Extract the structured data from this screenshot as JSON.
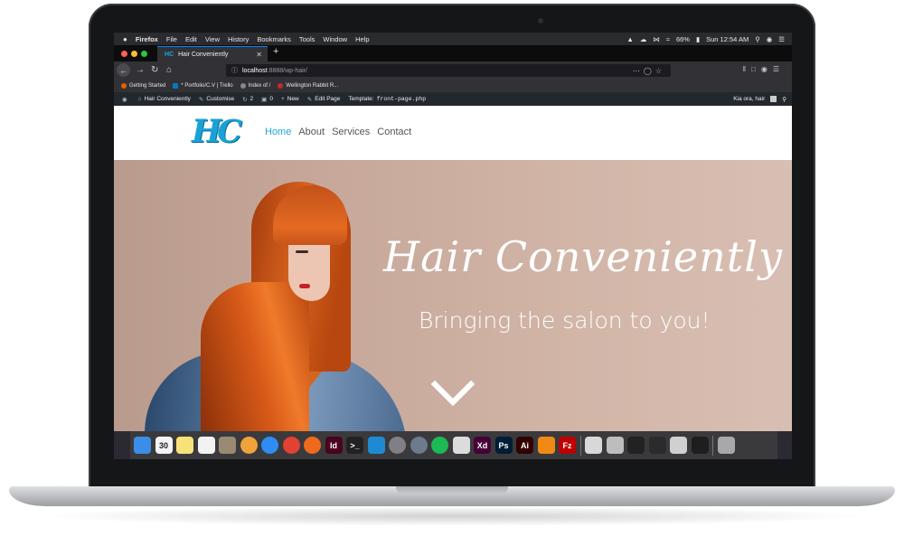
{
  "menubar": {
    "apple": "",
    "app": "Firefox",
    "items": [
      "File",
      "Edit",
      "View",
      "History",
      "Bookmarks",
      "Tools",
      "Window",
      "Help"
    ],
    "battery": "66%",
    "clock": "Sun 12:54 AM"
  },
  "tab": {
    "title": "Hair Conveniently",
    "close": "✕",
    "new": "+"
  },
  "url": {
    "host": "localhost",
    "path": ":8888/wp-hair/"
  },
  "bookmarks": [
    {
      "label": "Getting Started",
      "color": "#e66000"
    },
    {
      "label": "* Portfolio/C.V | Trello",
      "color": "#0079bf"
    },
    {
      "label": "Index of /",
      "color": "#888888"
    },
    {
      "label": "Wellington Rabbit R...",
      "color": "#c62828"
    }
  ],
  "wpbar": {
    "site": "Hair Conveniently",
    "customise": "Customise",
    "updates": "2",
    "comments": "0",
    "new": "New",
    "edit": "Edit Page",
    "template_label": "Template:",
    "template_file": "front-page.php",
    "greeting": "Kia ora, hair"
  },
  "site": {
    "logo": "HC",
    "nav": [
      "Home",
      "About",
      "Services",
      "Contact"
    ]
  },
  "hero": {
    "title": "Hair Conveniently",
    "subtitle": "Bringing the salon to you!"
  },
  "dock": [
    {
      "name": "finder",
      "label": "",
      "color": "#3b8de8"
    },
    {
      "name": "calendar",
      "label": "30",
      "color": "#f4f4f4"
    },
    {
      "name": "notes",
      "label": "",
      "color": "#f7e27a"
    },
    {
      "name": "reminders",
      "label": "",
      "color": "#f2f2f2"
    },
    {
      "name": "preview",
      "label": "",
      "color": "#9a8a74"
    },
    {
      "name": "photos",
      "label": "",
      "color": "#f0a23b"
    },
    {
      "name": "safari",
      "label": "",
      "color": "#2f8df2"
    },
    {
      "name": "chrome",
      "label": "",
      "color": "#e34133"
    },
    {
      "name": "firefox",
      "label": "",
      "color": "#f06a1d"
    },
    {
      "name": "indesign",
      "label": "Id",
      "color": "#49021f"
    },
    {
      "name": "terminal",
      "label": ">_",
      "color": "#222222"
    },
    {
      "name": "vscode",
      "label": "",
      "color": "#1f8ad2"
    },
    {
      "name": "system-prefs",
      "label": "",
      "color": "#7f7f85"
    },
    {
      "name": "launchpad",
      "label": "",
      "color": "#6d7b8c"
    },
    {
      "name": "spotify",
      "label": "",
      "color": "#1db954"
    },
    {
      "name": "sequel",
      "label": "",
      "color": "#dcdcdc"
    },
    {
      "name": "xd",
      "label": "Xd",
      "color": "#470137"
    },
    {
      "name": "photoshop",
      "label": "Ps",
      "color": "#001d34"
    },
    {
      "name": "illustrator",
      "label": "Ai",
      "color": "#330000"
    },
    {
      "name": "vlc",
      "label": "",
      "color": "#f08a16"
    },
    {
      "name": "filezilla",
      "label": "Fz",
      "color": "#bf0000"
    },
    {
      "name": "window-1",
      "label": "",
      "color": "#d8d8d8"
    },
    {
      "name": "window-2",
      "label": "",
      "color": "#bdbdbd"
    },
    {
      "name": "window-3",
      "label": "",
      "color": "#222222"
    },
    {
      "name": "window-4",
      "label": "",
      "color": "#2b2b2b"
    },
    {
      "name": "window-5",
      "label": "",
      "color": "#d0d0d0"
    },
    {
      "name": "window-6",
      "label": "",
      "color": "#1e1e1e"
    },
    {
      "name": "trash",
      "label": "",
      "color": "#a8a8ab"
    }
  ]
}
